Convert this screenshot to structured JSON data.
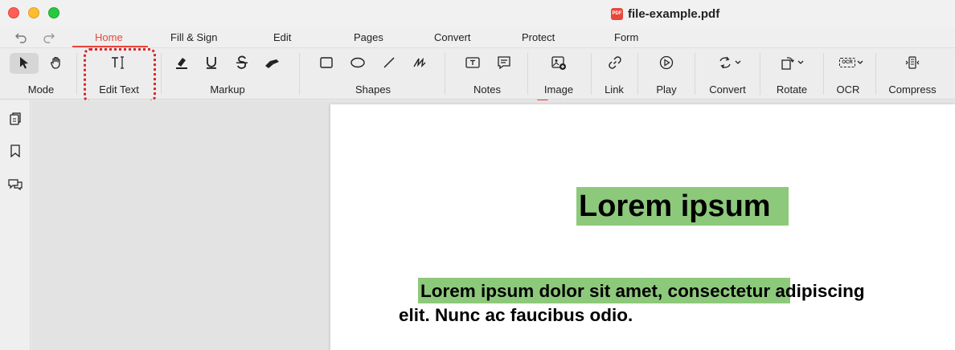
{
  "window": {
    "title": "file-example.pdf",
    "pdf_badge": "PDF"
  },
  "tabs": [
    "Home",
    "Fill & Sign",
    "Edit",
    "Pages",
    "Convert",
    "Protect",
    "Form"
  ],
  "active_tab": "Home",
  "toolbar": {
    "groups": {
      "mode": "Mode",
      "edit_text": "Edit Text",
      "markup": "Markup",
      "shapes": "Shapes",
      "notes": "Notes",
      "image": "Image",
      "link": "Link",
      "play": "Play",
      "convert": "Convert",
      "rotate": "Rotate",
      "ocr": "OCR",
      "compress": "Compress"
    },
    "ocr_icon_text": "OCR"
  },
  "document": {
    "heading": "Lorem ipsum",
    "paragraph_line1_highlighted": "Lorem ipsum dolor sit amet, consec",
    "paragraph_line1_rest": "tetur adipiscing",
    "paragraph_line2": "elit. Nunc ac faucibus odio."
  },
  "colors": {
    "accent": "#e8473b",
    "highlight": "#8dc97b",
    "annotation_box": "#d8262b"
  }
}
